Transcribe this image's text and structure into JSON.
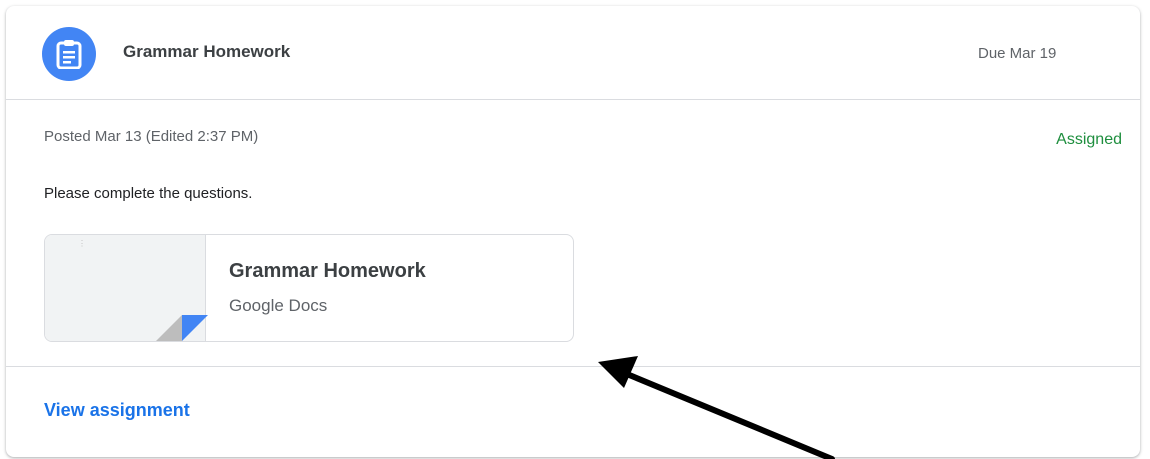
{
  "header": {
    "title": "Grammar Homework",
    "due": "Due Mar 19",
    "icon": "assignment-icon"
  },
  "details": {
    "posted": "Posted Mar 13 (Edited 2:37 PM)",
    "status": "Assigned",
    "instructions": "Please complete the questions."
  },
  "attachment": {
    "title": "Grammar Homework",
    "type": "Google Docs",
    "icon": "google-docs-thumbnail"
  },
  "footer": {
    "link_label": "View assignment"
  },
  "colors": {
    "accent_blue": "#4285f4",
    "link_blue": "#1a73e8",
    "status_green": "#1e8e3e",
    "annotation_arrow": "#000000"
  }
}
